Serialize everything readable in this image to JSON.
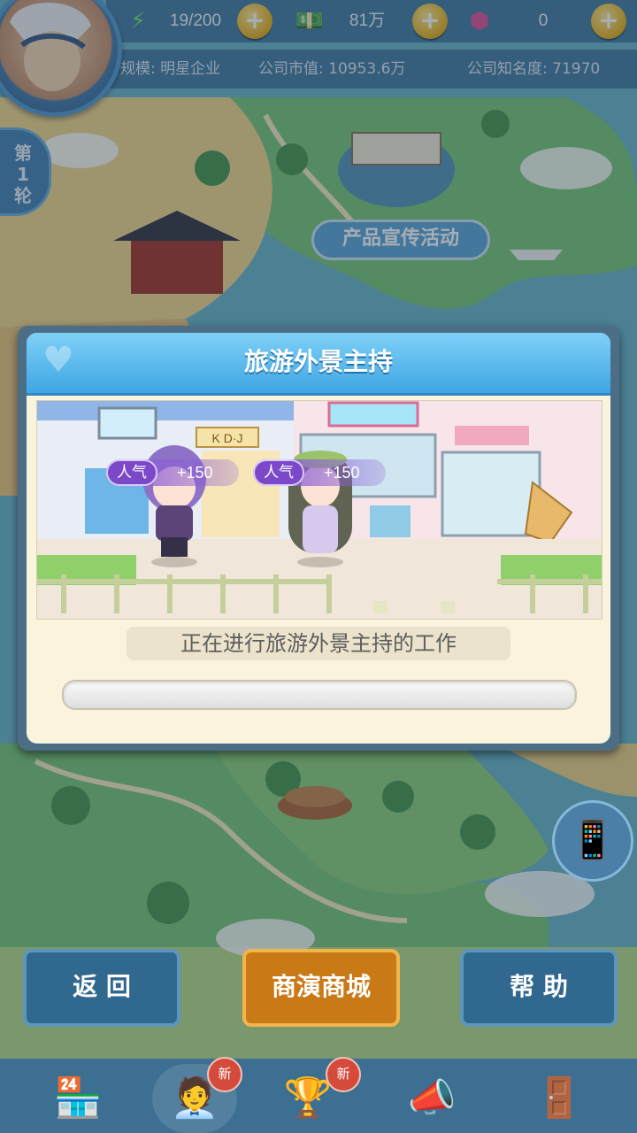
{
  "resources": {
    "energy": "19/200",
    "money": "81万",
    "gems": "0"
  },
  "company": {
    "scale": "规模: 明星企业",
    "market_value": "公司市值: 10953.6万",
    "fame": "公司知名度: 71970"
  },
  "round_badge": "第\n1\n轮",
  "map_labels": {
    "product_promo": "产品宣传活动"
  },
  "dialog": {
    "title": "旅游外景主持",
    "status": "正在进行旅游外景主持的工作",
    "progress": 0.0,
    "shop_sign": "K D·J",
    "characters": [
      {
        "badge": "人气",
        "value": "+150"
      },
      {
        "badge": "人气",
        "value": "+150"
      }
    ]
  },
  "buttons": {
    "back": "返 回",
    "shop": "商演商城",
    "help": "帮 助"
  },
  "nav": {
    "new_badge_1": "新",
    "new_badge_2": "新"
  },
  "icons": {
    "energy": "lightning-icon",
    "money": "cash-icon",
    "gems": "gem-icon",
    "plus": "plus-icon",
    "phone": "phone-icon"
  },
  "colors": {
    "header_blue": "#3fa6e4",
    "dialog_bg": "#faf4dc",
    "shop_orange": "#c97a16",
    "nav_blue": "#31688f",
    "popularity_purple": "#7b48c9"
  }
}
